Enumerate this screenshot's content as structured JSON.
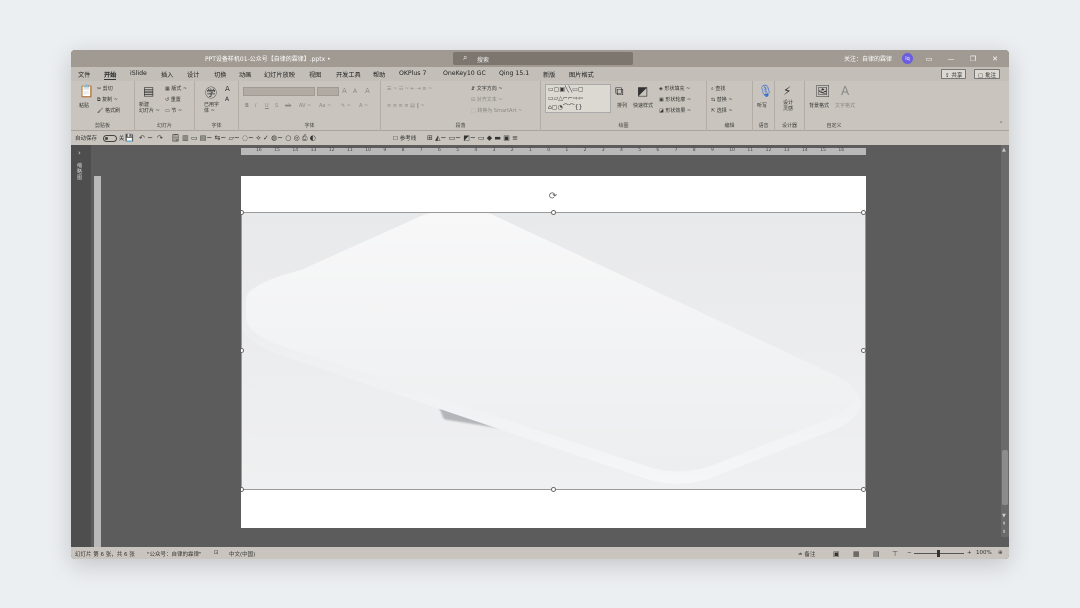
{
  "titlebar": {
    "title": "PPT设备样机01-公众号【自律的霖律】.pptx  •",
    "search_label": "搜索",
    "user_label": "关注：自律的霖律",
    "avatar_initials": "lq"
  },
  "tabs": [
    "文件",
    "开始",
    "iSlide",
    "插入",
    "设计",
    "切换",
    "动画",
    "幻灯片放映",
    "视图",
    "开发工具",
    "帮助",
    "OKPlus 7",
    "OneKey10 GC",
    "Qing 15.1",
    "新版",
    "图片格式"
  ],
  "active_tab": "开始",
  "share_label": "共享",
  "comment_label": "批注",
  "ribbon": {
    "clipboard": {
      "paste": "粘贴",
      "cut": "剪切",
      "copy": "复制 ~",
      "format_painter": "格式刷",
      "label": "剪贴板"
    },
    "slides": {
      "new_slide": "新建\n幻灯片 ~",
      "layout": "版式 ~",
      "reset": "重置",
      "section": "节 ~",
      "label": "幻灯片"
    },
    "reuse": {
      "label_text": "已用字\n体 ~"
    },
    "font": {
      "label": "字体",
      "bold": "B",
      "italic": "I",
      "underline": "U",
      "strike": "S",
      "spacing": "ab",
      "case": "Aa ~"
    },
    "paragraph": {
      "label": "段落",
      "text_direction": "文字方向 ~",
      "align_text": "对齐文本 ~",
      "smartart": "转换为 SmartArt ~"
    },
    "drawing": {
      "label": "绘图",
      "arrange": "排列",
      "quick_styles": "快速样式",
      "fill": "形状填充 ~",
      "outline": "形状轮廓 ~",
      "effects": "形状效果 ~"
    },
    "editing": {
      "label": "编辑",
      "find": "查找",
      "replace": "替换 ~",
      "select": "选择 ~"
    },
    "voice": {
      "label": "语音",
      "dictate": "听写"
    },
    "designer": {
      "label": "设计器",
      "ideas": "设计\n灵感"
    },
    "custom": {
      "label": "自定义",
      "bg_format": "背景格式",
      "text_format": "文字格式"
    }
  },
  "qat": {
    "autosave": "自动保存",
    "autosave_state": "关",
    "reference_line": "参考线"
  },
  "ruler_h": [
    "16",
    "15",
    "14",
    "13",
    "12",
    "11",
    "10",
    "9",
    "8",
    "7",
    "6",
    "5",
    "4",
    "3",
    "2",
    "1",
    "0",
    "1",
    "2",
    "3",
    "4",
    "5",
    "6",
    "7",
    "8",
    "9",
    "10",
    "11",
    "12",
    "13",
    "14",
    "15",
    "16"
  ],
  "leftpane_label": "缩略图",
  "statusbar": {
    "slide_info": "幻灯片 第 6 张，共 6 张",
    "theme": "\"公众号：自律的霖律\"",
    "language": "中文(中国)",
    "notes": "备注",
    "zoom": "100%"
  },
  "colors": {
    "titlebar": "#a19a92",
    "ribbon": "#c9c4bd",
    "workspace": "#5c5c5c",
    "avatar": "#6a5de0"
  }
}
